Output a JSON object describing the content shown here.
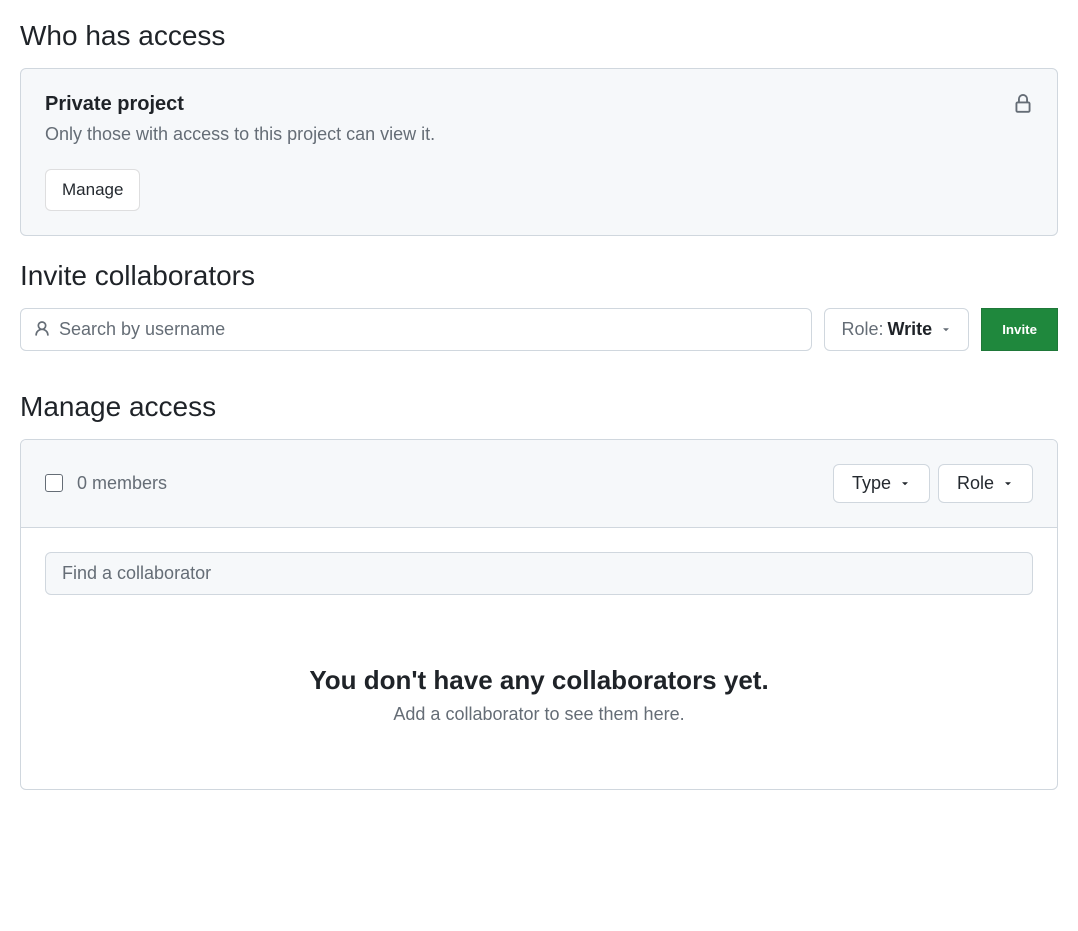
{
  "sections": {
    "who_has_access": {
      "heading": "Who has access",
      "card_title": "Private project",
      "card_desc": "Only those with access to this project can view it.",
      "manage_button": "Manage"
    },
    "invite": {
      "heading": "Invite collaborators",
      "search_placeholder": "Search by username",
      "role_label": "Role: ",
      "role_value": "Write",
      "invite_button": "Invite"
    },
    "manage_access": {
      "heading": "Manage access",
      "member_count": "0 members",
      "type_filter": "Type",
      "role_filter": "Role",
      "find_placeholder": "Find a collaborator",
      "empty_title": "You don't have any collaborators yet.",
      "empty_desc": "Add a collaborator to see them here."
    }
  }
}
